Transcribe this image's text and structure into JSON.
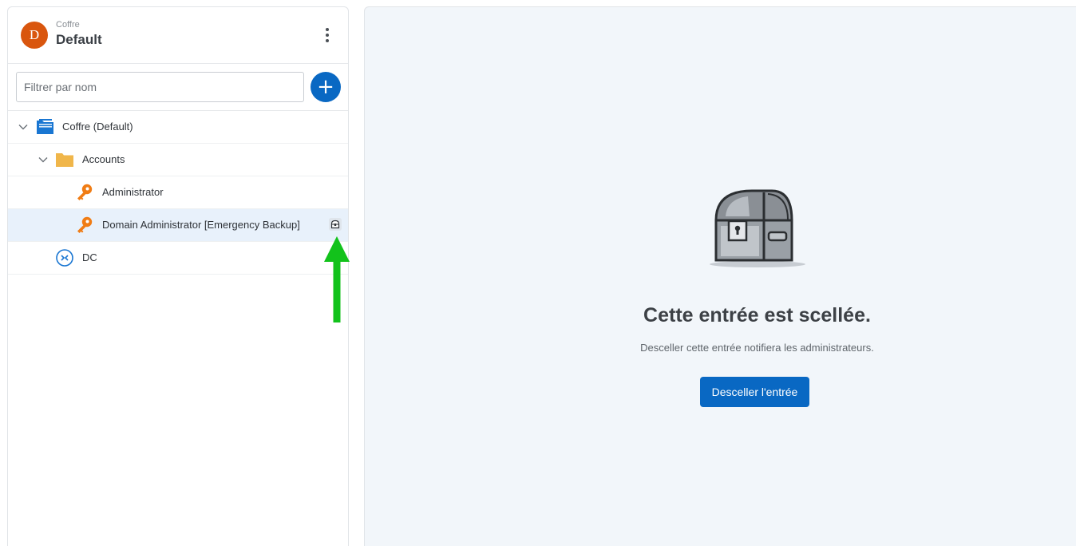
{
  "vault": {
    "avatar_letter": "D",
    "caption": "Coffre",
    "name": "Default"
  },
  "filter": {
    "placeholder": "Filtrer par nom",
    "value": ""
  },
  "tree": {
    "root": "Coffre (Default)",
    "folder": "Accounts",
    "entries": [
      "Administrator",
      "Domain Administrator [Emergency Backup]"
    ],
    "session": "DC"
  },
  "sealed": {
    "title": "Cette entrée est scellée.",
    "subtitle": "Desceller cette entrée notifiera les administrateurs.",
    "button_label": "Desceller l'entrée"
  },
  "colors": {
    "accent": "#0968c3",
    "avatar": "#d9560e",
    "key": "#f07c14",
    "folder": "#f0b64a",
    "arrow": "#12c21b",
    "selected_row": "#e8f1fb",
    "content_bg": "#f2f6fa"
  },
  "icons": {
    "vault": "vault-folder-icon",
    "folder": "folder-icon",
    "credential": "key-icon",
    "session": "remote-desktop-icon",
    "sealed": "sealed-icon",
    "add": "plus-icon",
    "menu": "kebab-menu-icon",
    "expand": "chevron-down-icon",
    "illustration": "treasure-chest-icon",
    "pointer": "green-arrow-icon"
  }
}
